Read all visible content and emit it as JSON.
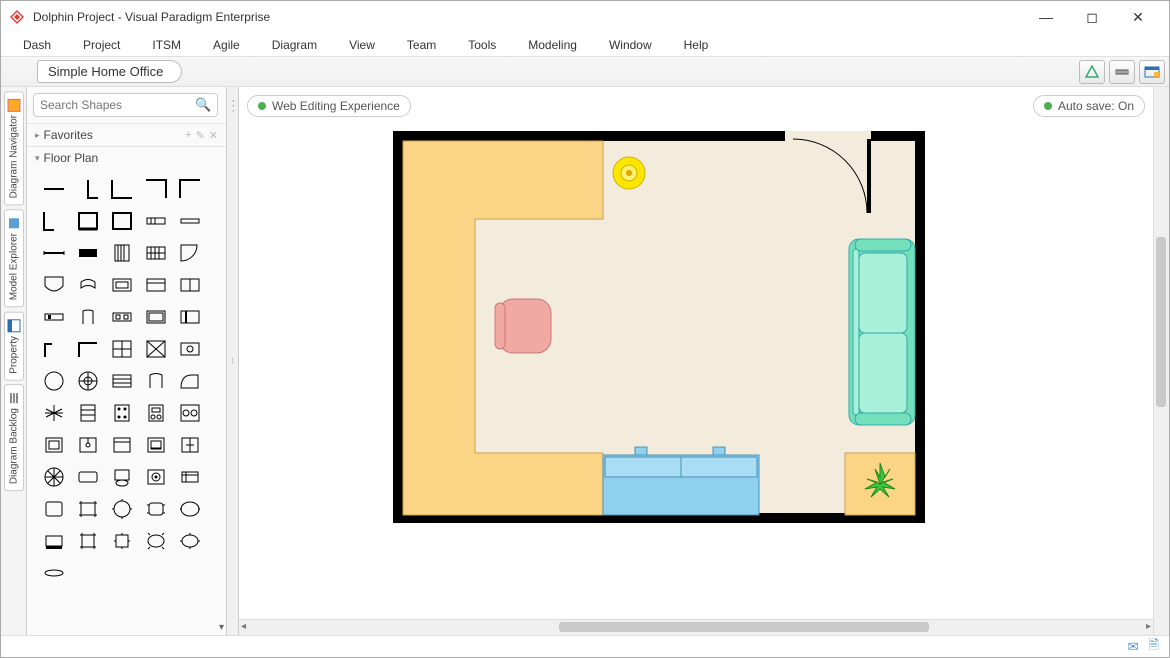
{
  "window": {
    "title": "Dolphin Project - Visual Paradigm Enterprise"
  },
  "menubar": [
    "Dash",
    "Project",
    "ITSM",
    "Agile",
    "Diagram",
    "View",
    "Team",
    "Tools",
    "Modeling",
    "Window",
    "Help"
  ],
  "breadcrumb": "Simple Home Office",
  "side_tabs": [
    "Diagram Navigator",
    "Model Explorer",
    "Property",
    "Diagram Backlog"
  ],
  "search": {
    "placeholder": "Search Shapes"
  },
  "sections": {
    "favorites": {
      "label": "Favorites"
    },
    "floorplan": {
      "label": "Floor Plan"
    }
  },
  "canvas": {
    "web_badge": "Web Editing Experience",
    "autosave": "Auto save: On"
  },
  "floorplan_objects": {
    "desk_color": "#fbd485",
    "chair_color": "#f0a9a3",
    "sofa_color": "#74e0bb",
    "cabinet_color": "#8fd0ee",
    "rug_color": "#fbd485",
    "lamp_color": "#ffe600",
    "plant_color": "#3ec63e",
    "wall_color": "#000000",
    "floor_color": "#f3ebdc"
  }
}
